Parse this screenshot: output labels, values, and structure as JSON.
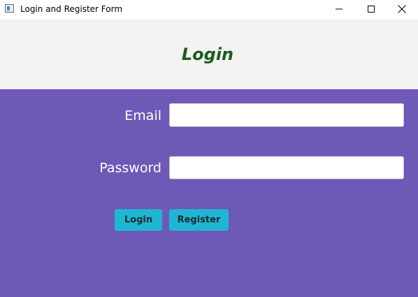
{
  "window": {
    "title": "Login and Register Form"
  },
  "header": {
    "title": "Login"
  },
  "form": {
    "email_label": "Email",
    "email_value": "",
    "password_label": "Password",
    "password_value": "",
    "login_button": "Login",
    "register_button": "Register"
  },
  "colors": {
    "header_background": "#f3f3f3",
    "header_title": "#1f5a1f",
    "form_background": "#6f59b7",
    "button_background": "#1fb6d4"
  },
  "icons": {
    "app": "app-icon",
    "minimize": "minimize-icon",
    "maximize": "maximize-icon",
    "close": "close-icon"
  }
}
